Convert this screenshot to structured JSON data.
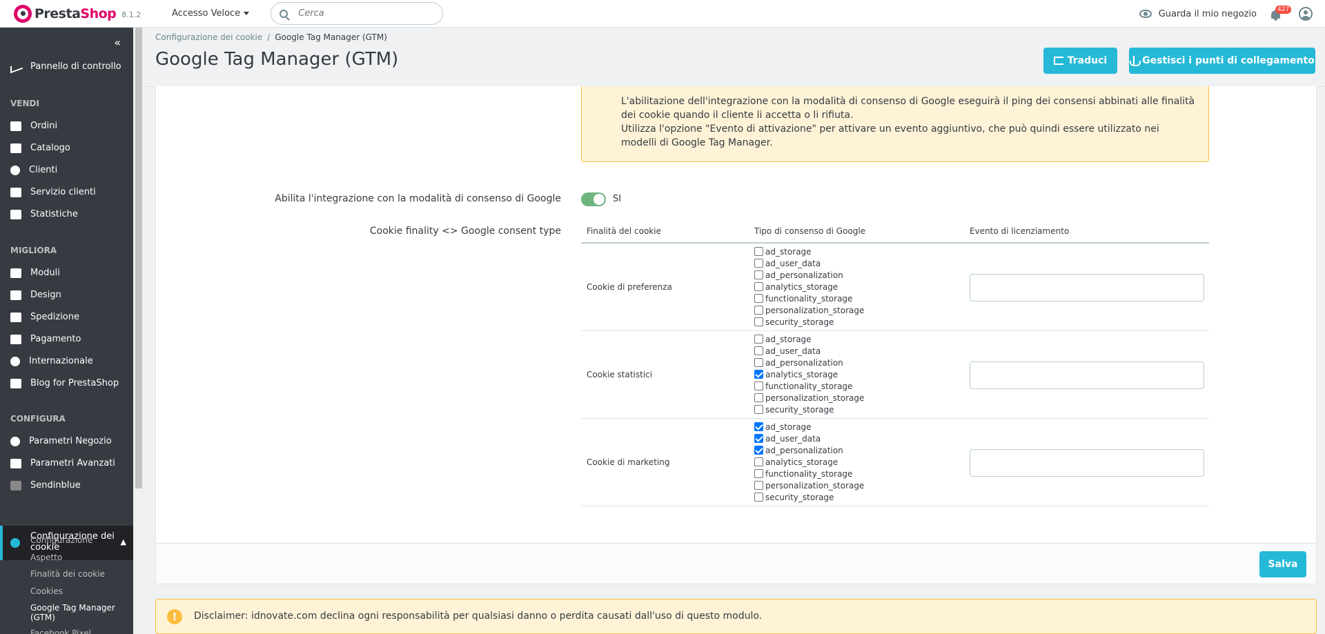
{
  "header": {
    "logo_a": "Presta",
    "logo_b": "Shop",
    "version": "8.1.2",
    "quick_access": "Accesso Veloce",
    "search_placeholder": "Cerca",
    "view_shop": "Guarda il mio negozio",
    "notifications_count": "427"
  },
  "sidebar": {
    "collapse_glyph": "«",
    "dashboard": "Pannello di controllo",
    "sections": {
      "sell": "VENDI",
      "improve": "MIGLIORA",
      "configure": "CONFIGURA"
    },
    "sell_items": [
      "Ordini",
      "Catalogo",
      "Clienti",
      "Servizio clienti",
      "Statistiche"
    ],
    "improve_items": [
      "Moduli",
      "Design",
      "Spedizione",
      "Pagamento",
      "Internazionale",
      "Blog for PrestaShop"
    ],
    "configure_items": [
      "Parametri Negozio",
      "Parametri Avanzati",
      "Sendinblue"
    ],
    "active_item_line1": "Configurazione dei",
    "active_item_line2": "cookie",
    "sub_items": [
      "Configurazione",
      "Aspetto",
      "Finalità dei cookie",
      "Cookies"
    ],
    "current_sub_line1": "Google Tag Manager",
    "current_sub_line2": "(GTM)",
    "next_sub": "Facebook Pixel"
  },
  "breadcrumb": {
    "parent": "Configurazione dei cookie",
    "separator": "/",
    "current": "Google Tag Manager (GTM)"
  },
  "page": {
    "title": "Google Tag Manager (GTM)",
    "translate_button": "Traduci",
    "hooks_button": "Gestisci i punti di collegamento"
  },
  "warning": {
    "line1": "L'abilitazione dell'integrazione con la modalità di consenso di Google eseguirà il ping dei consensi abbinati alle finalità dei cookie quando il cliente li accetta o li rifiuta.",
    "line2": "Utilizza l'opzione \"Evento di attivazione\" per attivare un evento aggiuntivo, che può quindi essere utilizzato nei modelli di Google Tag Manager."
  },
  "form": {
    "consent_label": "Abilita l'integrazione con la modalità di consenso di Google",
    "consent_value": "SI",
    "mapping_label": "Cookie finality <> Google consent type",
    "table_headers": [
      "Finalità del cookie",
      "Tipo di consenso di Google",
      "Evento di licenziamento"
    ],
    "rows": [
      {
        "label": "Cookie di preferenza",
        "options": [
          {
            "name": "ad_storage",
            "checked": false
          },
          {
            "name": "ad_user_data",
            "checked": false
          },
          {
            "name": "ad_personalization",
            "checked": false
          },
          {
            "name": "analytics_storage",
            "checked": false
          },
          {
            "name": "functionality_storage",
            "checked": false
          },
          {
            "name": "personalization_storage",
            "checked": false
          },
          {
            "name": "security_storage",
            "checked": false
          }
        ],
        "event_value": ""
      },
      {
        "label": "Cookie statistici",
        "options": [
          {
            "name": "ad_storage",
            "checked": false
          },
          {
            "name": "ad_user_data",
            "checked": false
          },
          {
            "name": "ad_personalization",
            "checked": false
          },
          {
            "name": "analytics_storage",
            "checked": true
          },
          {
            "name": "functionality_storage",
            "checked": false
          },
          {
            "name": "personalization_storage",
            "checked": false
          },
          {
            "name": "security_storage",
            "checked": false
          }
        ],
        "event_value": ""
      },
      {
        "label": "Cookie di marketing",
        "options": [
          {
            "name": "ad_storage",
            "checked": true
          },
          {
            "name": "ad_user_data",
            "checked": true
          },
          {
            "name": "ad_personalization",
            "checked": true
          },
          {
            "name": "analytics_storage",
            "checked": false
          },
          {
            "name": "functionality_storage",
            "checked": false
          },
          {
            "name": "personalization_storage",
            "checked": false
          },
          {
            "name": "security_storage",
            "checked": false
          }
        ],
        "event_value": ""
      }
    ],
    "save_button": "Salva"
  },
  "disclaimer": {
    "icon": "!",
    "text": "Disclaimer: idnovate.com declina ogni responsabilità per qualsiasi danno o perdita causati dall'uso di questo modulo."
  },
  "colors": {
    "accent": "#25b9d7",
    "sidebar_bg": "#363a41",
    "brand": "#df0067",
    "switch_on": "#70b580",
    "warning_bg": "#fff3d7",
    "warning_border": "#fcbd3c"
  }
}
